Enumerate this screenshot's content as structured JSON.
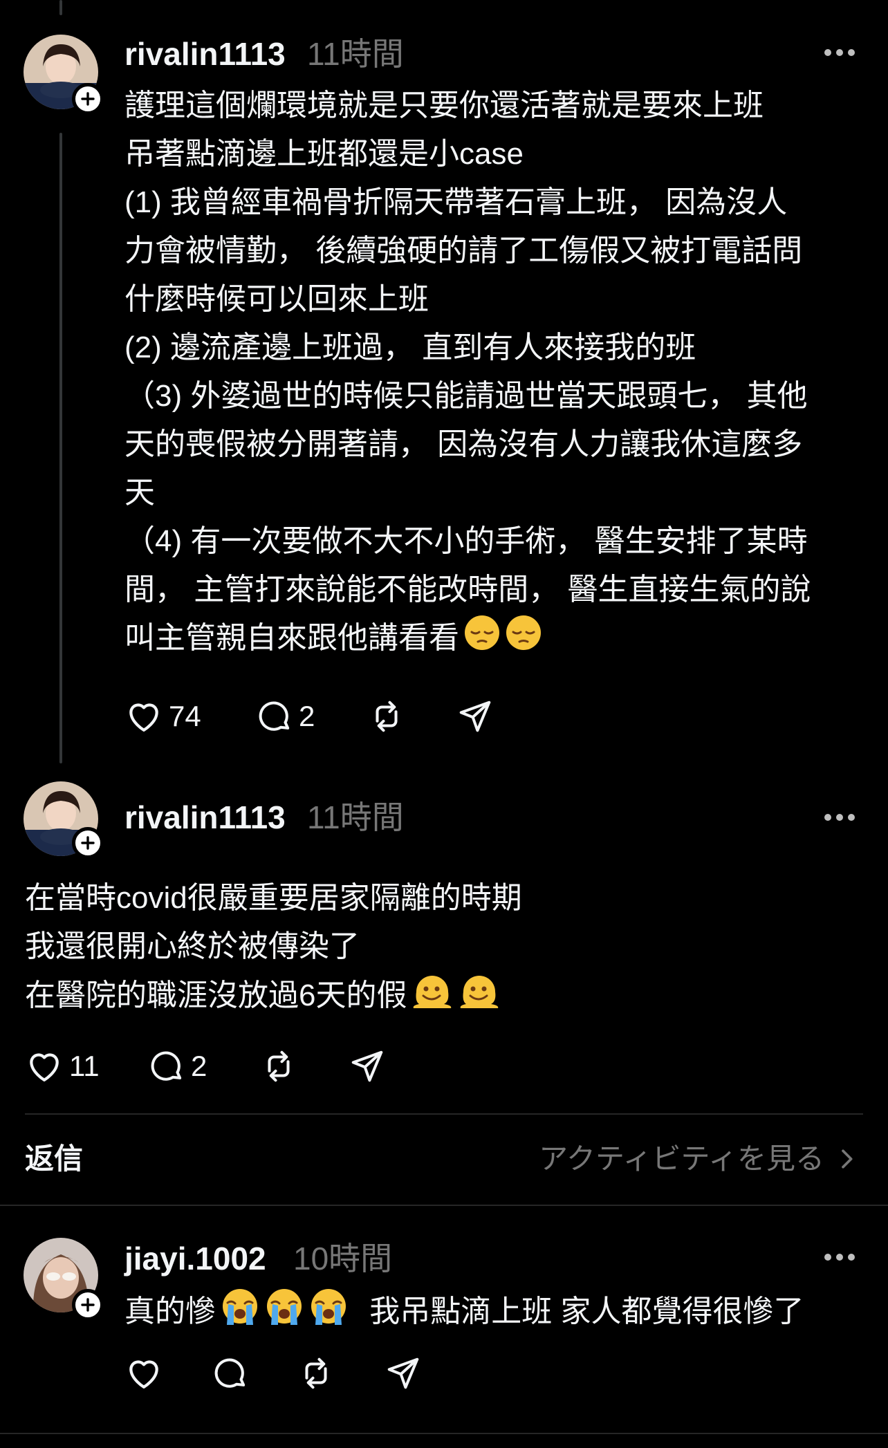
{
  "posts": [
    {
      "username": "rivalin1113",
      "time": "11時間",
      "lines": [
        "護理這個爛環境就是只要你還活著就是要來上班",
        "吊著點滴邊上班都還是小case",
        "(1) 我曾經車禍骨折隔天帶著石膏上班， 因為沒人",
        "力會被情勤， 後續強硬的請了工傷假又被打電話問",
        "什麼時候可以回來上班",
        "(2) 邊流產邊上班過， 直到有人來接我的班",
        "（3) 外婆過世的時候只能請過世當天跟頭七， 其他",
        "天的喪假被分開著請， 因為沒有人力讓我休這麼多",
        "天",
        "（4) 有一次要做不大不小的手術， 醫生安排了某時",
        "間， 主管打來說能不能改時間， 醫生直接生氣的說",
        "叫主管親自來跟他講看看"
      ],
      "emoji_tail": [
        "pensive-face",
        "pensive-face"
      ],
      "likes": "74",
      "replies": "2"
    },
    {
      "username": "rivalin1113",
      "time": "11時間",
      "lines": [
        "在當時covid很嚴重要居家隔離的時期",
        "我還很開心終於被傳染了",
        "在醫院的職涯沒放過6天的假"
      ],
      "emoji_tail": [
        "melting-face",
        "melting-face"
      ],
      "likes": "11",
      "replies": "2"
    },
    {
      "username": "jiayi.1002",
      "time": "10時間",
      "text_before": "真的慘",
      "emojis": [
        "loudly-crying-face",
        "loudly-crying-face",
        "loudly-crying-face"
      ],
      "text_after": "我吊點滴上班 家人都覺得很慘了",
      "likes": "",
      "replies": ""
    }
  ],
  "section": {
    "label": "返信",
    "activity_link": "アクティビティを見る"
  },
  "colors": {
    "background": "#000000",
    "text": "#f3f5f7",
    "muted": "#777777",
    "divider": "#262626"
  }
}
